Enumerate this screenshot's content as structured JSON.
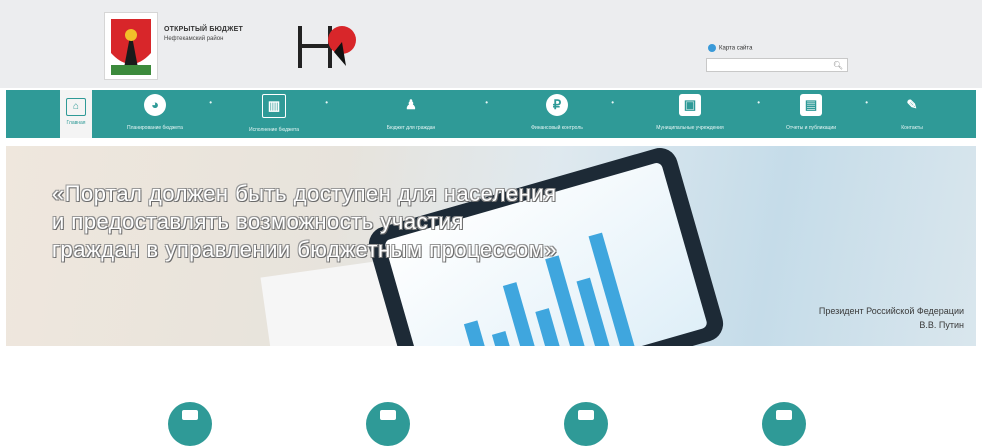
{
  "header": {
    "site_title": "ОТКРЫТЫЙ БЮДЖЕТ",
    "site_subtitle": "Нефтекамский район",
    "map_link": "Карта сайта",
    "search_placeholder": ""
  },
  "nav": {
    "items": [
      {
        "label": "Главная",
        "icon": "home-icon"
      },
      {
        "label": "Планирование бюджета",
        "icon": "pie-chart-icon"
      },
      {
        "label": "Исполнение бюджета",
        "icon": "bar-chart-icon"
      },
      {
        "label": "Бюджет для граждан",
        "icon": "people-icon"
      },
      {
        "label": "Финансовый контроль",
        "icon": "ruble-icon"
      },
      {
        "label": "Муниципальные учреждения",
        "icon": "briefcase-icon"
      },
      {
        "label": "Отчеты и публикации",
        "icon": "document-icon"
      },
      {
        "label": "Контакты",
        "icon": "notes-icon"
      }
    ]
  },
  "banner": {
    "quote_lines": [
      "«Портал должен быть доступен для населения",
      "и предоставлять возможность участия",
      "граждан в управлении бюджетным процессом»"
    ],
    "attribution_line1": "Президент Российской Федерации",
    "attribution_line2": "В.В. Путин"
  },
  "colors": {
    "accent": "#2f9a97",
    "header_bg": "#ecedef"
  }
}
